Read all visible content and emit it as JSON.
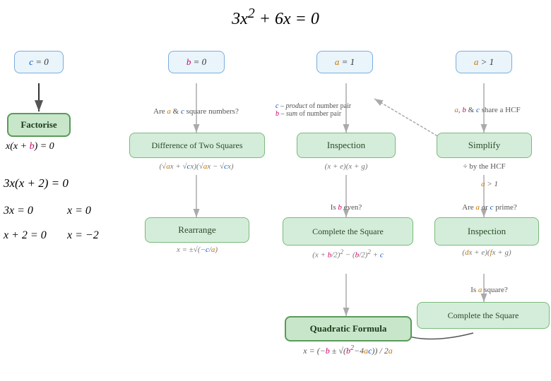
{
  "title": "3x² + 6x = 0",
  "left_panel": {
    "c_eq_0_label": "c = 0",
    "factorise_label": "Factorise",
    "factorise_result": "x(x + b) = 0",
    "step1": "3x(x + 2) = 0",
    "step2a": "3x = 0",
    "step2b": "x = 0",
    "step3a": "x + 2 = 0",
    "step3b": "x = −2"
  },
  "b_eq_0": "b = 0",
  "a_eq_1": "a = 1",
  "a_gt_1_top": "a > 1",
  "diff_two_squares": "Difference of Two Squares",
  "inspection_mid": "Inspection",
  "simplify": "Simplify",
  "rearrange": "Rearrange",
  "complete_square_mid": "Complete the Square",
  "inspection_right": "Inspection",
  "complete_square_right": "Complete the Square",
  "quadratic_formula": "Quadratic Formula",
  "are_a_c_square": "Are a & c square numbers?",
  "c_product": "c – product of number pair",
  "b_sum": "b – sum of number pair",
  "a_b_c_hcf": "a, b & c share a HCF",
  "div_hcf": "÷ by the HCF",
  "a_gt_1_mid": "a > 1",
  "is_b_even": "Is b even?",
  "are_a_c_prime": "Are a or c prime?",
  "is_a_square": "Is a square?",
  "diff_formula": "(√ax + √cx)(√ax − √cx)",
  "inspection_formula": "(x + e)(x + g)",
  "rearrange_formula": "x = ±√(−c/a)",
  "complete_formula": "(x + b/2)² − (b/2)² + c",
  "inspection_right_formula": "(dx + e)(fx + g)",
  "quadratic_formula_expr": "x = (−b ± √(b²−4ac)) / 2a"
}
